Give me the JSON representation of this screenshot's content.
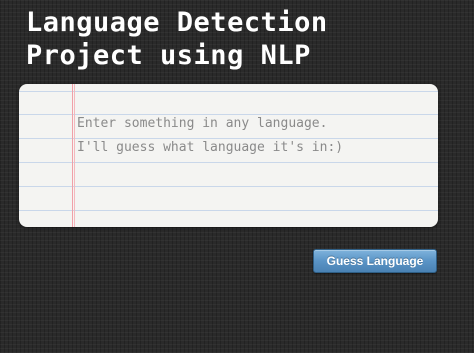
{
  "header": {
    "title_line1": "Language Detection",
    "title_line2": "Project using NLP"
  },
  "input": {
    "value": "",
    "placeholder": "Enter something in any language.\nI'll guess what language it's in:)"
  },
  "actions": {
    "guess_label": "Guess Language"
  },
  "colors": {
    "background": "#2a2a2a",
    "paper": "#f4f4f2",
    "margin_line": "#f0a0a8",
    "ruled_line": "#c9d7ea",
    "button": "#5a94c6"
  }
}
